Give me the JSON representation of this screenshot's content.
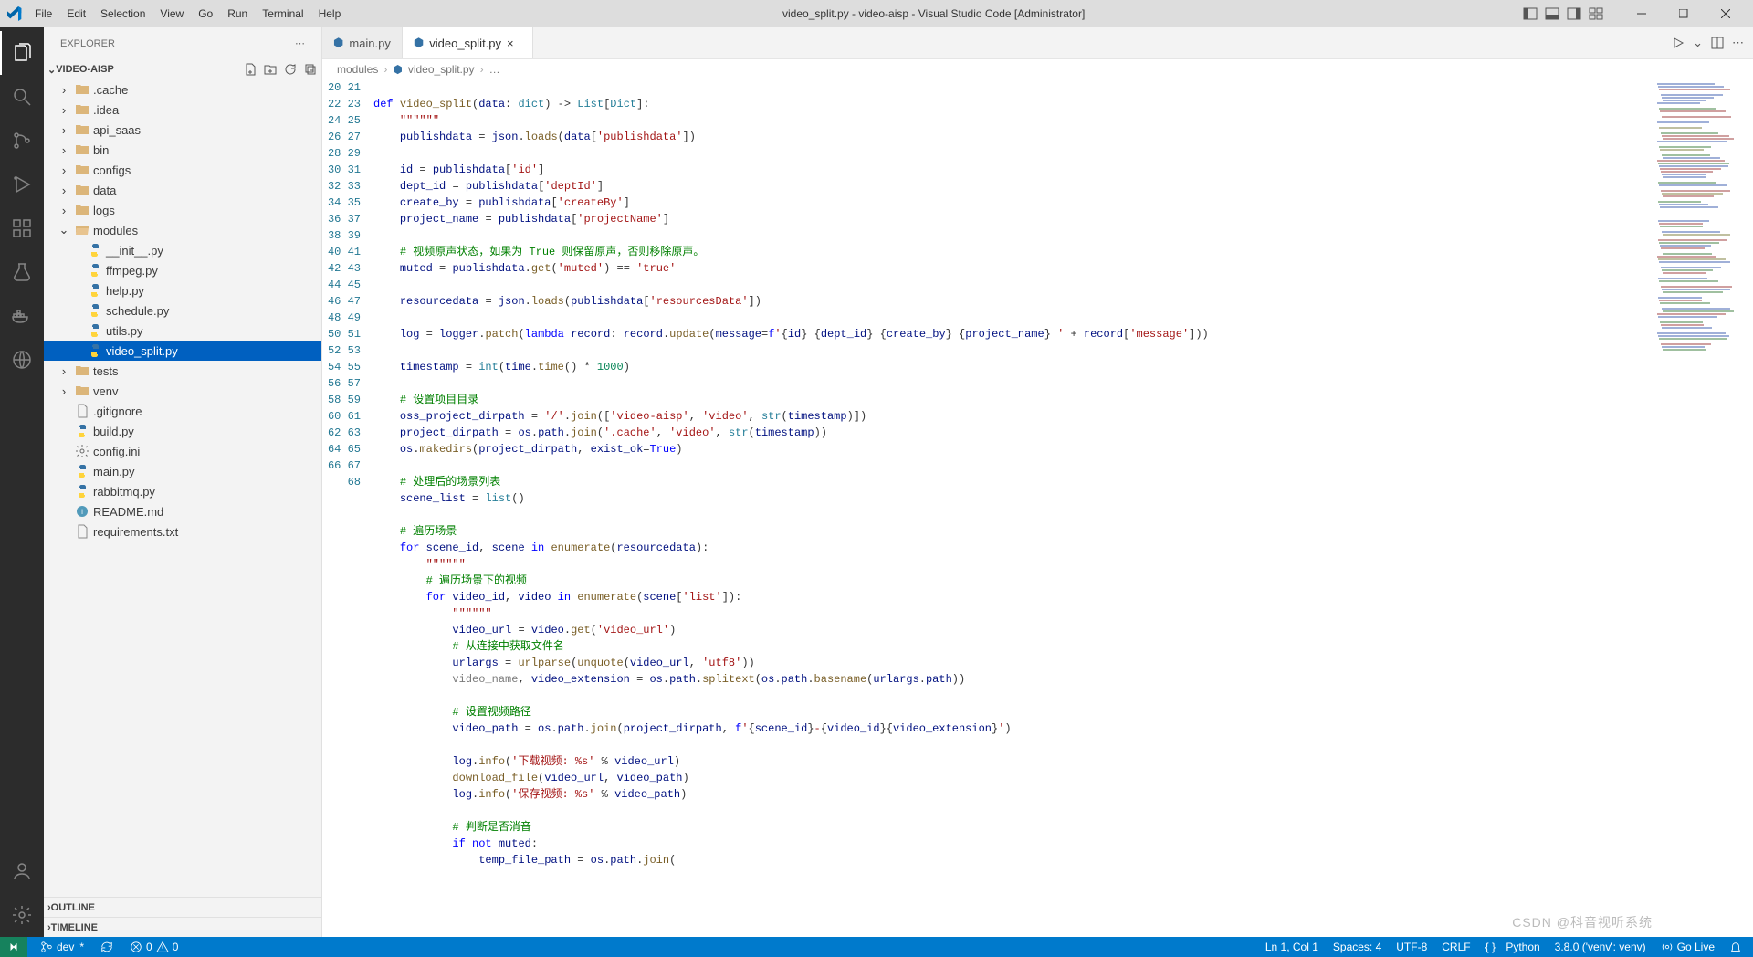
{
  "title": "video_split.py - video-aisp - Visual Studio Code [Administrator]",
  "menu": [
    "File",
    "Edit",
    "Selection",
    "View",
    "Go",
    "Run",
    "Terminal",
    "Help"
  ],
  "explorer": {
    "title": "EXPLORER",
    "project": "VIDEO-AISP",
    "outline": "OUTLINE",
    "timeline": "TIMELINE",
    "tree": [
      {
        "d": 1,
        "k": "folder",
        "label": ".cache",
        "exp": false
      },
      {
        "d": 1,
        "k": "folder",
        "label": ".idea",
        "exp": false
      },
      {
        "d": 1,
        "k": "folder",
        "label": "api_saas",
        "exp": false
      },
      {
        "d": 1,
        "k": "folder",
        "label": "bin",
        "exp": false
      },
      {
        "d": 1,
        "k": "folder",
        "label": "configs",
        "exp": false
      },
      {
        "d": 1,
        "k": "folder",
        "label": "data",
        "exp": false
      },
      {
        "d": 1,
        "k": "folder",
        "label": "logs",
        "exp": false
      },
      {
        "d": 1,
        "k": "folder",
        "label": "modules",
        "exp": true
      },
      {
        "d": 2,
        "k": "py",
        "label": "__init__.py"
      },
      {
        "d": 2,
        "k": "py",
        "label": "ffmpeg.py"
      },
      {
        "d": 2,
        "k": "py",
        "label": "help.py"
      },
      {
        "d": 2,
        "k": "py",
        "label": "schedule.py"
      },
      {
        "d": 2,
        "k": "py",
        "label": "utils.py"
      },
      {
        "d": 2,
        "k": "py",
        "label": "video_split.py",
        "sel": true
      },
      {
        "d": 1,
        "k": "folder",
        "label": "tests",
        "exp": false
      },
      {
        "d": 1,
        "k": "folder",
        "label": "venv",
        "exp": false
      },
      {
        "d": 1,
        "k": "file",
        "label": ".gitignore"
      },
      {
        "d": 1,
        "k": "py",
        "label": "build.py"
      },
      {
        "d": 1,
        "k": "cog",
        "label": "config.ini"
      },
      {
        "d": 1,
        "k": "py",
        "label": "main.py"
      },
      {
        "d": 1,
        "k": "py",
        "label": "rabbitmq.py"
      },
      {
        "d": 1,
        "k": "md",
        "label": "README.md"
      },
      {
        "d": 1,
        "k": "file",
        "label": "requirements.txt"
      }
    ]
  },
  "tabs": [
    {
      "label": "main.py",
      "icon": "py",
      "active": false
    },
    {
      "label": "video_split.py",
      "icon": "py",
      "active": true
    }
  ],
  "breadcrumb": [
    "modules",
    "video_split.py",
    "…"
  ],
  "line_start": 20,
  "line_end": 67,
  "status": {
    "branch": "dev",
    "sync": "",
    "errors": "0",
    "warnings": "0",
    "pos": "Ln 1, Col 1",
    "spaces": "Spaces: 4",
    "encoding": "UTF-8",
    "eol": "CRLF",
    "lang": "Python",
    "interp": "3.8.0 ('venv': venv)",
    "golive": "Go Live"
  },
  "watermark": "CSDN @科音视听系统",
  "chart_data": null
}
